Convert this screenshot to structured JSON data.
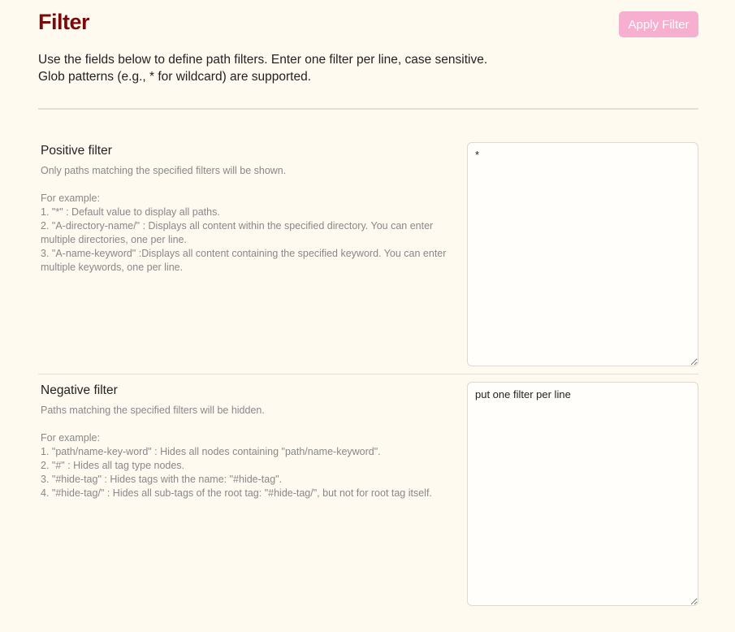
{
  "header": {
    "title": "Filter",
    "apply_button_label": "Apply Filter",
    "description_line1": "Use the fields below to define path filters. Enter one filter per line, case sensitive.",
    "description_line2": "Glob patterns (e.g., * for wildcard) are supported."
  },
  "positive": {
    "name": "Positive filter",
    "summary": "Only paths matching the specified filters will be shown.",
    "example_heading": "For example:",
    "examples": [
      "1. \"*\" : Default value to display all paths.",
      "2. \"A-directory-name/\" : Displays all content within the specified directory. You can enter multiple directories, one per line.",
      "3. \"A-name-keyword\" :Displays all content containing the specified keyword. You can enter multiple keywords, one per line."
    ],
    "value": "*",
    "placeholder": ""
  },
  "negative": {
    "name": "Negative filter",
    "summary": "Paths matching the specified filters will be hidden.",
    "example_heading": "For example:",
    "examples": [
      "1. \"path/name-key-word\" : Hides all nodes containing \"path/name-keyword\".",
      "2. \"#\" : Hides all tag type nodes.",
      "3. \"#hide-tag\" : Hides tags with the name: \"#hide-tag\".",
      "4. \"#hide-tag/\" : Hides all sub-tags of the root tag: \"#hide-tag/\", but not for root tag itself."
    ],
    "value": "",
    "placeholder": "put one filter per line"
  },
  "colors": {
    "title": "#7a0a0a",
    "apply_button": "#f7afcf",
    "background": "#fffaf0"
  }
}
